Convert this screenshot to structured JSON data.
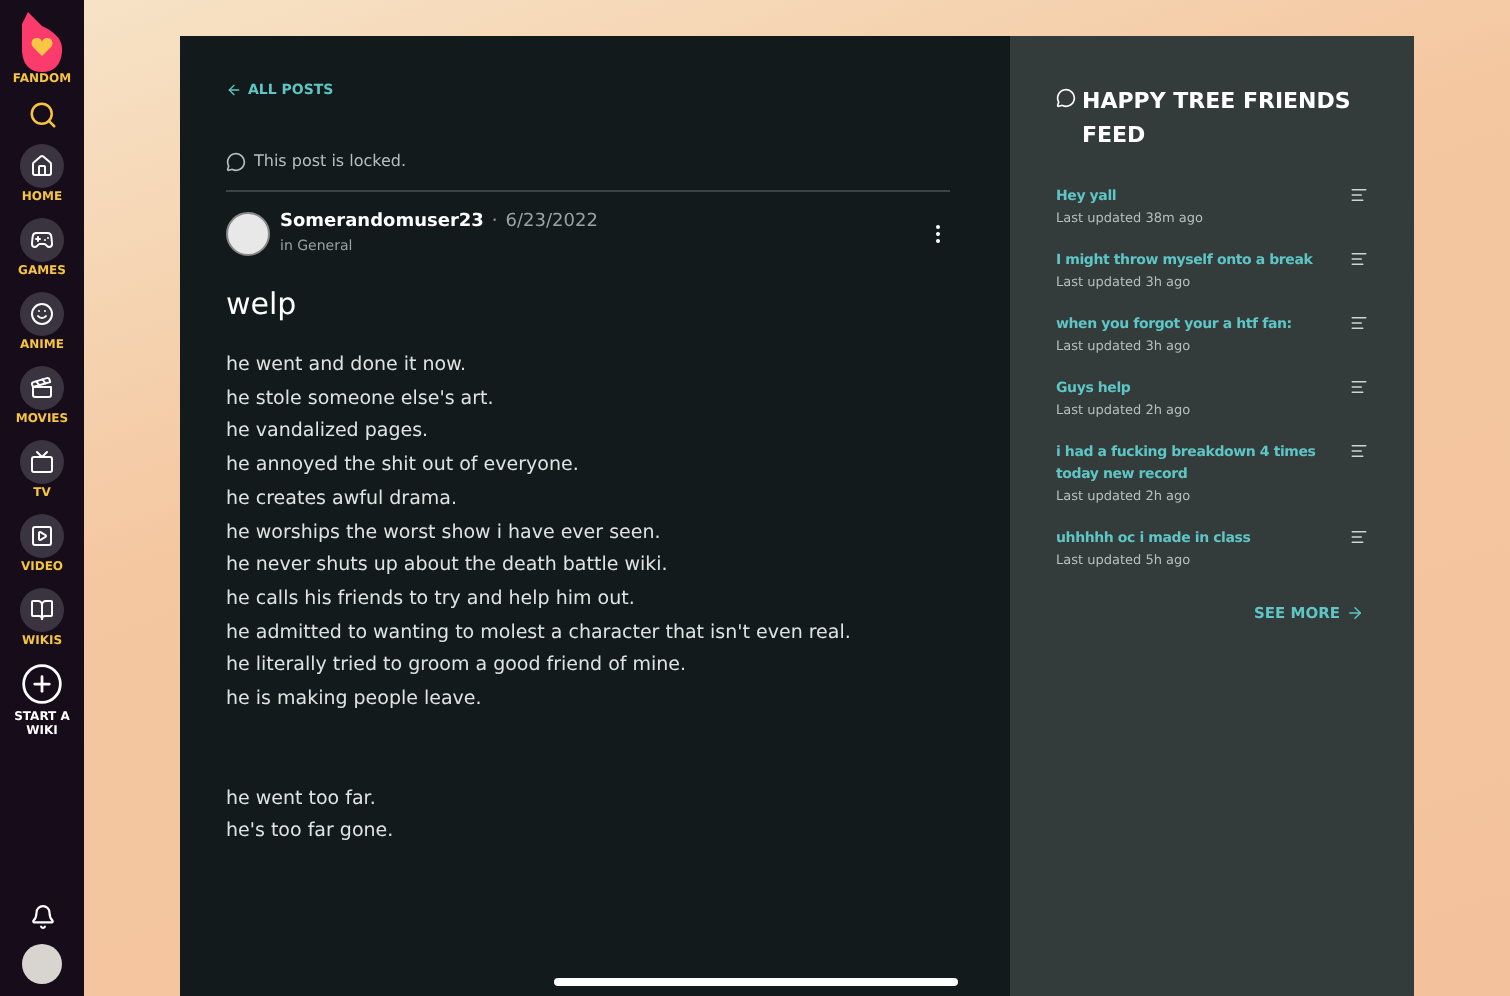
{
  "sidebar": {
    "logo_label": "FANDOM",
    "items": [
      {
        "kind": "nav",
        "label": "HOME"
      },
      {
        "kind": "nav",
        "label": "GAMES"
      },
      {
        "kind": "nav",
        "label": "ANIME"
      },
      {
        "kind": "nav",
        "label": "MOVIES"
      },
      {
        "kind": "nav",
        "label": "TV"
      },
      {
        "kind": "nav",
        "label": "VIDEO"
      },
      {
        "kind": "nav",
        "label": "WIKIS"
      },
      {
        "kind": "create",
        "label": "START A WIKI"
      }
    ]
  },
  "post": {
    "back_link": "ALL POSTS",
    "locked_notice": "This post is locked.",
    "author": "Somerandomuser23",
    "separator": "·",
    "date": "6/23/2022",
    "category": "in General",
    "title": "welp",
    "body": [
      "he went and done it now.",
      "he stole someone else's art.",
      "he vandalized pages.",
      "he annoyed the shit out of everyone.",
      "he creates awful drama.",
      "he worships the worst show i have ever seen.",
      "he never shuts up about the death battle wiki.",
      "he calls his friends to try and help him out.",
      "he admitted to wanting to molest a character that isn't even real.",
      "he literally tried to groom a good friend of mine.",
      "he is making people leave."
    ],
    "body_end": [
      "he went too far.",
      "he's too far gone."
    ]
  },
  "feed": {
    "title": "HAPPY TREE FRIENDS FEED",
    "items": [
      {
        "title": "Hey yall",
        "updated": "Last updated 38m ago"
      },
      {
        "title": "I might throw myself onto a break",
        "updated": "Last updated 3h ago"
      },
      {
        "title": "when you forgot your a htf fan:",
        "updated": "Last updated 3h ago"
      },
      {
        "title": "Guys help",
        "updated": "Last updated 2h ago"
      },
      {
        "title": "i had a fucking breakdown 4 times today new record",
        "updated": "Last updated 2h ago"
      },
      {
        "title": "uhhhhh oc i made in class",
        "updated": "Last updated 5h ago"
      }
    ],
    "see_more": "SEE MORE"
  }
}
